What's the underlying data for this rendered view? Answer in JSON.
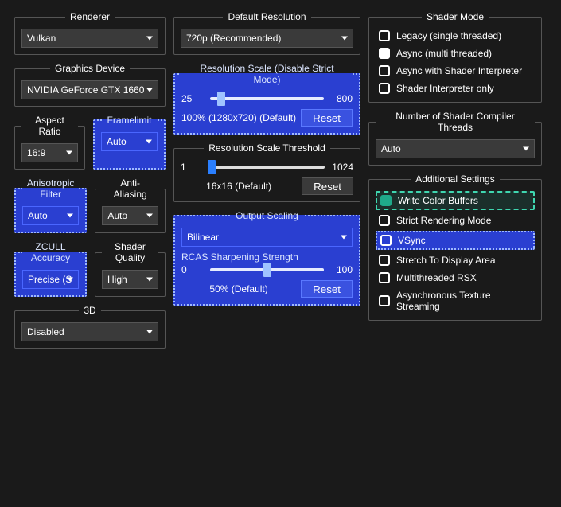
{
  "renderer": {
    "title": "Renderer",
    "value": "Vulkan"
  },
  "default_res": {
    "title": "Default Resolution",
    "value": "720p (Recommended)"
  },
  "gfx_device": {
    "title": "Graphics Device",
    "value": "NVIDIA GeForce GTX 1660"
  },
  "aspect": {
    "title": "Aspect Ratio",
    "value": "16:9"
  },
  "framelimit": {
    "title": "Framelimit",
    "value": "Auto"
  },
  "aniso": {
    "title": "Anisotropic Filter",
    "value": "Auto"
  },
  "aa": {
    "title": "Anti-Aliasing",
    "value": "Auto"
  },
  "zcull": {
    "title": "ZCULL Accuracy",
    "value": "Precise (S"
  },
  "shader_q": {
    "title": "Shader Quality",
    "value": "High"
  },
  "three_d": {
    "title": "3D",
    "value": "Disabled"
  },
  "res_scale": {
    "title": "Resolution Scale (Disable Strict Mode)",
    "min": "25",
    "max": "800",
    "status": "100% (1280x720) (Default)",
    "reset": "Reset",
    "thumb_pct": 10
  },
  "res_thresh": {
    "title": "Resolution Scale Threshold",
    "min": "1",
    "max": "1024",
    "status": "16x16 (Default)",
    "reset": "Reset",
    "thumb_pct": 2
  },
  "out_scaling": {
    "title": "Output Scaling",
    "value": "Bilinear",
    "rcas_label": "RCAS Sharpening Strength",
    "min": "0",
    "max": "100",
    "status": "50% (Default)",
    "reset": "Reset",
    "thumb_pct": 50
  },
  "shader_mode": {
    "title": "Shader Mode",
    "opts": [
      "Legacy (single threaded)",
      "Async (multi threaded)",
      "Async with Shader Interpreter",
      "Shader Interpreter only"
    ],
    "selected": 1
  },
  "shader_threads": {
    "title": "Number of Shader Compiler Threads",
    "value": "Auto"
  },
  "addl": {
    "title": "Additional Settings",
    "opts": [
      "Write Color Buffers",
      "Strict Rendering Mode",
      "VSync",
      "Stretch To Display Area",
      "Multithreaded RSX",
      "Asynchronous Texture Streaming"
    ]
  }
}
